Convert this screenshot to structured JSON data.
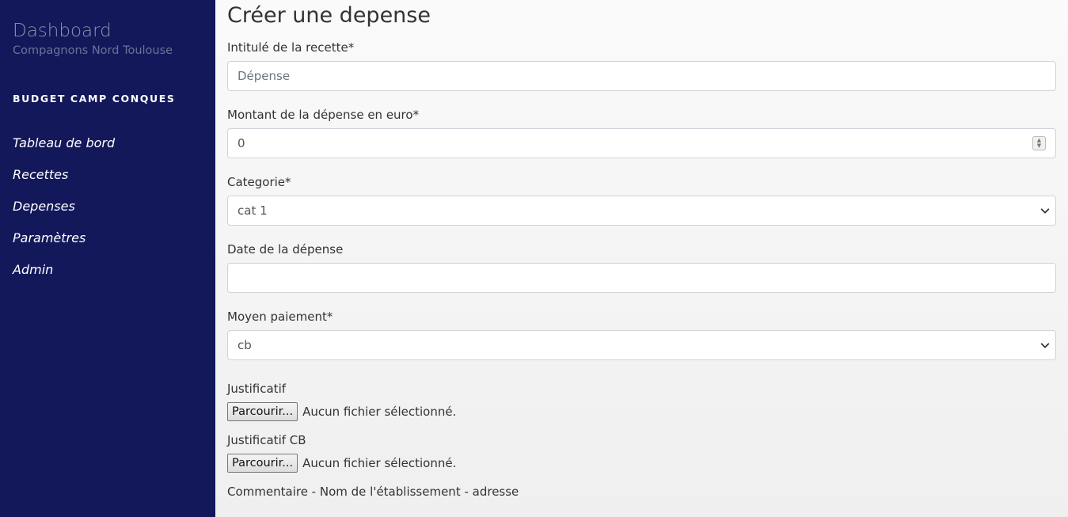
{
  "sidebar": {
    "title": "Dashboard",
    "subtitle": "Compagnons Nord Toulouse",
    "section": "BUDGET CAMP CONQUES",
    "items": [
      {
        "label": "Tableau de bord"
      },
      {
        "label": "Recettes"
      },
      {
        "label": "Depenses"
      },
      {
        "label": "Paramètres"
      },
      {
        "label": "Admin"
      }
    ]
  },
  "form": {
    "title": "Créer une depense",
    "intitule": {
      "label": "Intitulé de la recette*",
      "placeholder": "Dépense"
    },
    "montant": {
      "label": "Montant de la dépense en euro*",
      "value": "0"
    },
    "categorie": {
      "label": "Categorie*",
      "value": "cat 1"
    },
    "date": {
      "label": "Date de la dépense",
      "value": ""
    },
    "moyen": {
      "label": "Moyen paiement*",
      "value": "cb"
    },
    "justificatif": {
      "label": "Justificatif",
      "button": "Parcourir...",
      "status": "Aucun fichier sélectionné."
    },
    "justificatif_cb": {
      "label": "Justificatif CB",
      "button": "Parcourir...",
      "status": "Aucun fichier sélectionné."
    },
    "commentaire": {
      "label": "Commentaire - Nom de l'établissement - adresse"
    }
  },
  "colors": {
    "sidebar_bg": "#13185a",
    "page_bg": "#f5f5f5"
  }
}
